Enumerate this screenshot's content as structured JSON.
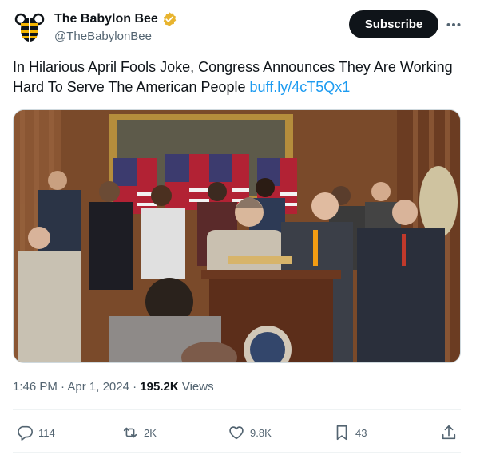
{
  "account": {
    "name": "The Babylon Bee",
    "handle": "@TheBabylonBee",
    "verified_badge_color": "#e8b42f"
  },
  "header": {
    "subscribe_label": "Subscribe",
    "more_icon": "more-horizontal-icon"
  },
  "tweet": {
    "text": "In Hilarious April Fools Joke, Congress Announces They Are Working Hard To Serve The American People",
    "link": "buff.ly/4cT5Qx1",
    "link_color": "#1d9bf0"
  },
  "meta": {
    "time": "1:46 PM",
    "separator": "·",
    "date": "Apr 1, 2024",
    "views_count": "195.2K",
    "views_label": "Views"
  },
  "actions": {
    "replies": "114",
    "reposts": "2K",
    "likes": "9.8K",
    "bookmarks": "43"
  }
}
